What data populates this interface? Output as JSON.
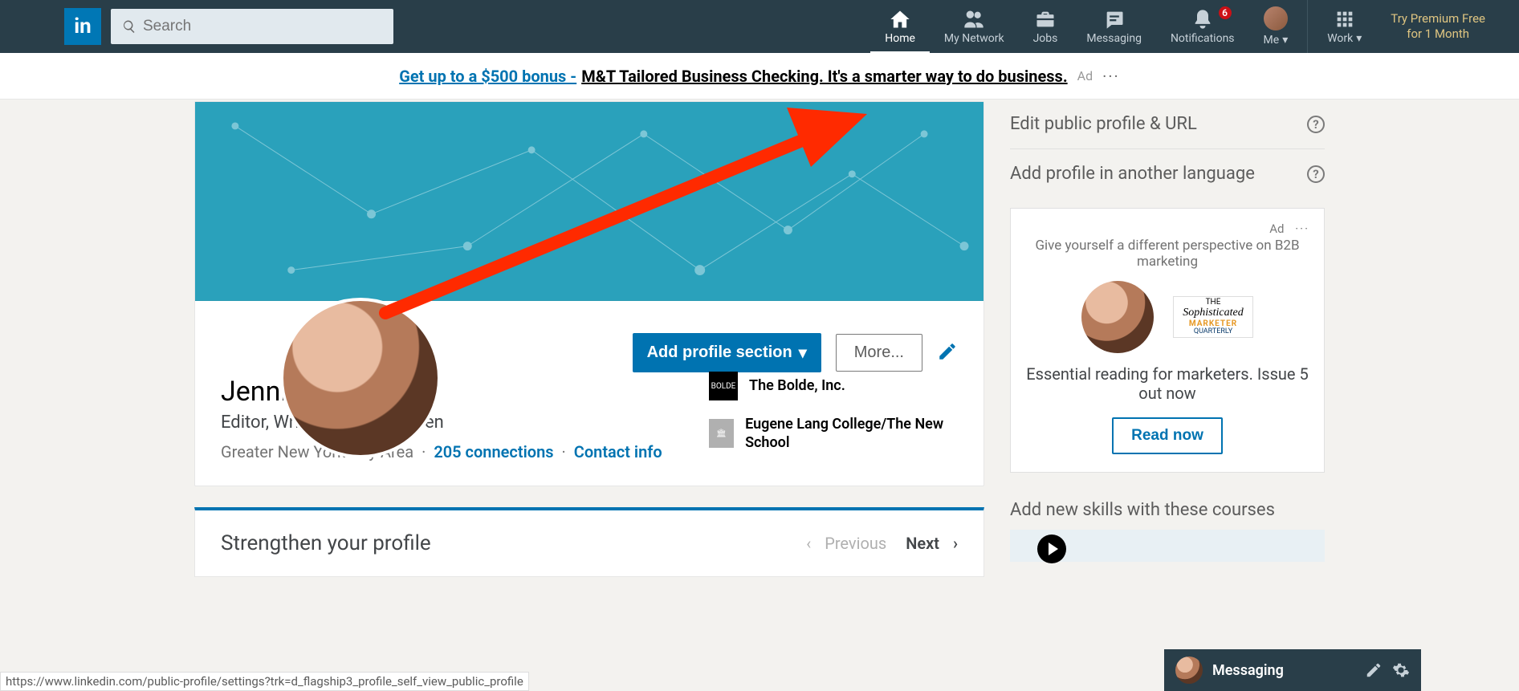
{
  "nav": {
    "search_placeholder": "Search",
    "items": {
      "home": "Home",
      "network": "My Network",
      "jobs": "Jobs",
      "messaging": "Messaging",
      "notifications": "Notifications",
      "notif_badge": "6",
      "me": "Me",
      "work": "Work"
    },
    "premium_line1": "Try Premium Free",
    "premium_line2": "for 1 Month"
  },
  "adstrip": {
    "bonus": "Get up to a $500 bonus - ",
    "rest": "M&T Tailored Business Checking. It's a smarter way to do business.",
    "adlabel": "Ad",
    "dots": "···"
  },
  "profile": {
    "add_section": "Add profile section",
    "more": "More...",
    "name": "Jennifer Still",
    "headline": "Editor, Writer, Content Queen",
    "location": "Greater New York City Area",
    "connections": "205 connections",
    "contact": "Contact info",
    "exp": [
      {
        "name": "The Bolde, Inc.",
        "logo": "BOLDE"
      },
      {
        "name": "Eugene Lang College/The New School",
        "logo": "🏛"
      }
    ]
  },
  "strengthen": {
    "title": "Strengthen your profile",
    "prev": "Previous",
    "next": "Next"
  },
  "sidebar": {
    "edit_url": "Edit public profile & URL",
    "add_lang": "Add profile in another language",
    "skills": "Add new skills with these courses"
  },
  "ad": {
    "adlabel": "Ad",
    "dots": "···",
    "subhead": "Give yourself a different perspective on B2B marketing",
    "brand_line1": "Sophisticated",
    "brand_line2": "MARKETER",
    "brand_line3": "QUARTERLY",
    "msg": "Essential reading for marketers. Issue 5 out now",
    "cta": "Read now"
  },
  "messaging_bar": {
    "title": "Messaging"
  },
  "status_url": "https://www.linkedin.com/public-profile/settings?trk=d_flagship3_profile_self_view_public_profile"
}
